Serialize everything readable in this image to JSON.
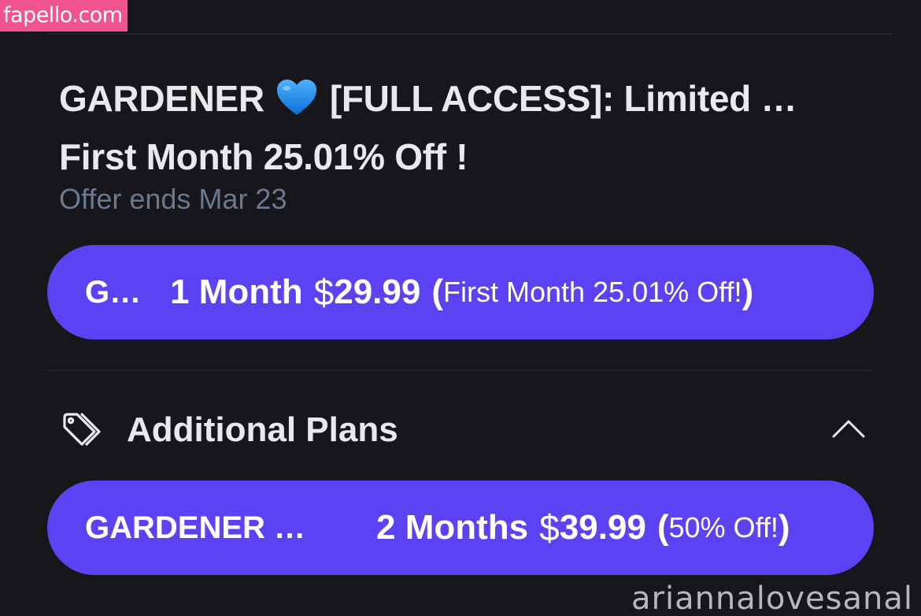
{
  "watermark": {
    "site": "fapello.com",
    "user": "ariannalovesanal"
  },
  "offer": {
    "title_part1": "GARDENER",
    "title_part2": "[FULL ACCESS]: Limited …",
    "title_line2": "First Month 25.01% Off !",
    "ends": "Offer ends Mar 23",
    "heart_icon": "blue-heart-icon"
  },
  "main_plan": {
    "name": "G…",
    "duration": "1 Month",
    "currency": "$",
    "price": "29.99",
    "paren_open": "(",
    "discount": "First Month 25.01% Off!",
    "paren_close": ")"
  },
  "additional_plans": {
    "label": "Additional Plans",
    "icon": "tag-icon",
    "toggle_icon": "chevron-up-icon",
    "plans": [
      {
        "name": "GARDENER …",
        "duration": "2 Months",
        "currency": "$",
        "price": "39.99",
        "paren_open": "(",
        "discount": "50% Off!",
        "paren_close": ")"
      }
    ]
  },
  "colors": {
    "background": "#17171b",
    "button": "#5b42f3",
    "muted_text": "#6a7890",
    "badge": "#f0548f",
    "heart": "#1e8ff0"
  }
}
